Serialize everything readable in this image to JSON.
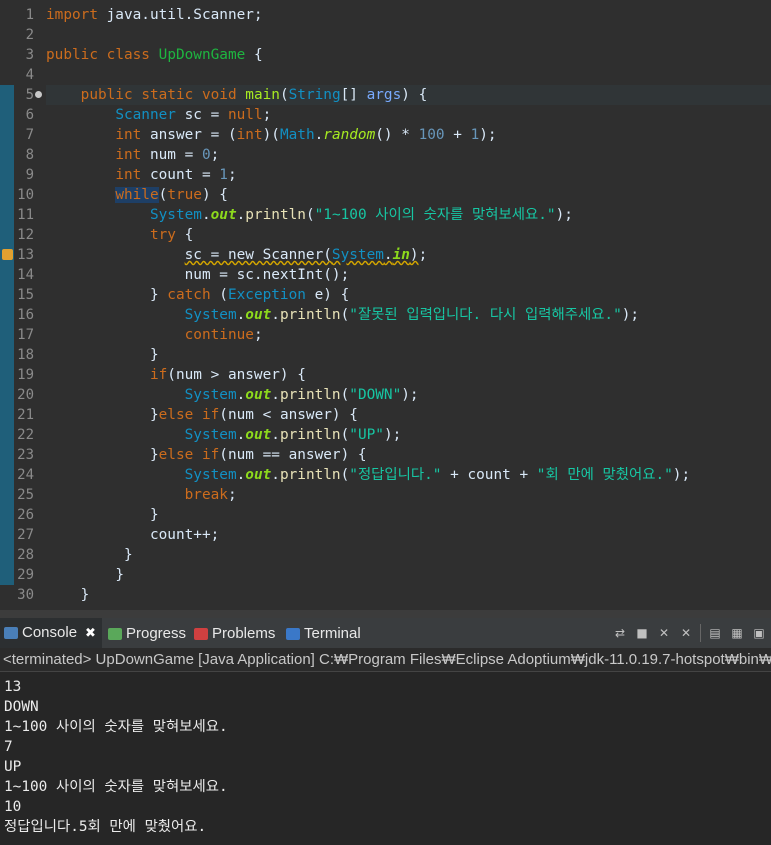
{
  "editor": {
    "lines": [
      {
        "n": "1",
        "tokens": [
          {
            "t": "import",
            "c": "kw"
          },
          {
            "t": " java.util.Scanner;",
            "c": "var"
          }
        ]
      },
      {
        "n": "2",
        "tokens": []
      },
      {
        "n": "3",
        "tokens": [
          {
            "t": "public",
            "c": "kw"
          },
          {
            "t": " "
          },
          {
            "t": "class",
            "c": "kw"
          },
          {
            "t": " "
          },
          {
            "t": "UpDownGame",
            "c": "cls"
          },
          {
            "t": " {"
          }
        ]
      },
      {
        "n": "4",
        "tokens": []
      },
      {
        "n": "5",
        "fold": true,
        "cur": true,
        "tokens": [
          {
            "t": "    "
          },
          {
            "t": "public",
            "c": "kw"
          },
          {
            "t": " "
          },
          {
            "t": "static",
            "c": "kw"
          },
          {
            "t": " "
          },
          {
            "t": "void",
            "c": "kw"
          },
          {
            "t": " "
          },
          {
            "t": "main",
            "c": "fn"
          },
          {
            "t": "("
          },
          {
            "t": "String",
            "c": "ty"
          },
          {
            "t": "[] "
          },
          {
            "t": "args",
            "c": "param"
          },
          {
            "t": ") {"
          }
        ]
      },
      {
        "n": "6",
        "tokens": [
          {
            "t": "        "
          },
          {
            "t": "Scanner",
            "c": "ty"
          },
          {
            "t": " sc = "
          },
          {
            "t": "null",
            "c": "kw"
          },
          {
            "t": ";"
          }
        ]
      },
      {
        "n": "7",
        "tokens": [
          {
            "t": "        "
          },
          {
            "t": "int",
            "c": "kw"
          },
          {
            "t": " answer = ("
          },
          {
            "t": "int",
            "c": "kw"
          },
          {
            "t": ")("
          },
          {
            "t": "Math",
            "c": "ty"
          },
          {
            "t": "."
          },
          {
            "t": "random",
            "c": "fn",
            "i": true
          },
          {
            "t": "() * "
          },
          {
            "t": "100",
            "c": "num"
          },
          {
            "t": " + "
          },
          {
            "t": "1",
            "c": "num"
          },
          {
            "t": ");"
          }
        ]
      },
      {
        "n": "8",
        "tokens": [
          {
            "t": "        "
          },
          {
            "t": "int",
            "c": "kw"
          },
          {
            "t": " num = "
          },
          {
            "t": "0",
            "c": "num"
          },
          {
            "t": ";"
          }
        ]
      },
      {
        "n": "9",
        "tokens": [
          {
            "t": "        "
          },
          {
            "t": "int",
            "c": "kw"
          },
          {
            "t": " count = "
          },
          {
            "t": "1",
            "c": "num"
          },
          {
            "t": ";"
          }
        ]
      },
      {
        "n": "10",
        "tokens": [
          {
            "t": "        "
          },
          {
            "t": "while",
            "c": "kw sel"
          },
          {
            "t": "("
          },
          {
            "t": "true",
            "c": "kw"
          },
          {
            "t": ") {"
          }
        ]
      },
      {
        "n": "11",
        "tokens": [
          {
            "t": "            "
          },
          {
            "t": "System",
            "c": "ty"
          },
          {
            "t": "."
          },
          {
            "t": "out",
            "c": "fld"
          },
          {
            "t": "."
          },
          {
            "t": "println",
            "c": "mth"
          },
          {
            "t": "("
          },
          {
            "t": "\"1~100 사이의 숫자를 맞혀보세요.\"",
            "c": "str"
          },
          {
            "t": ");"
          }
        ]
      },
      {
        "n": "12",
        "tokens": [
          {
            "t": "            "
          },
          {
            "t": "try",
            "c": "kw"
          },
          {
            "t": " {"
          }
        ]
      },
      {
        "n": "13",
        "warn": true,
        "tokens": [
          {
            "t": "                "
          },
          {
            "t": "sc = new Scanner(",
            "c": "var wavy"
          },
          {
            "t": "System",
            "c": "ty wavy"
          },
          {
            "t": ".",
            "c": "wavy"
          },
          {
            "t": "in",
            "c": "fld wavy"
          },
          {
            "t": ")",
            "c": "wavy"
          },
          {
            "t": ";"
          }
        ]
      },
      {
        "n": "14",
        "tokens": [
          {
            "t": "                "
          },
          {
            "t": "num = sc.nextInt();"
          }
        ]
      },
      {
        "n": "15",
        "tokens": [
          {
            "t": "            "
          },
          {
            "t": "} "
          },
          {
            "t": "catch",
            "c": "kw"
          },
          {
            "t": " ("
          },
          {
            "t": "Exception",
            "c": "ty"
          },
          {
            "t": " e) {"
          }
        ]
      },
      {
        "n": "16",
        "tokens": [
          {
            "t": "                "
          },
          {
            "t": "System",
            "c": "ty"
          },
          {
            "t": "."
          },
          {
            "t": "out",
            "c": "fld"
          },
          {
            "t": "."
          },
          {
            "t": "println",
            "c": "mth"
          },
          {
            "t": "("
          },
          {
            "t": "\"잘못된 입력입니다. 다시 입력해주세요.\"",
            "c": "str"
          },
          {
            "t": ");"
          }
        ]
      },
      {
        "n": "17",
        "tokens": [
          {
            "t": "                "
          },
          {
            "t": "continue",
            "c": "kw"
          },
          {
            "t": ";"
          }
        ]
      },
      {
        "n": "18",
        "tokens": [
          {
            "t": "            "
          },
          {
            "t": "}"
          }
        ]
      },
      {
        "n": "19",
        "tokens": [
          {
            "t": "            "
          },
          {
            "t": "if",
            "c": "kw"
          },
          {
            "t": "(num > answer) {"
          }
        ]
      },
      {
        "n": "20",
        "tokens": [
          {
            "t": "                "
          },
          {
            "t": "System",
            "c": "ty"
          },
          {
            "t": "."
          },
          {
            "t": "out",
            "c": "fld"
          },
          {
            "t": "."
          },
          {
            "t": "println",
            "c": "mth"
          },
          {
            "t": "("
          },
          {
            "t": "\"DOWN\"",
            "c": "str"
          },
          {
            "t": ");"
          }
        ]
      },
      {
        "n": "21",
        "tokens": [
          {
            "t": "            "
          },
          {
            "t": "}"
          },
          {
            "t": "else",
            "c": "kw"
          },
          {
            "t": " "
          },
          {
            "t": "if",
            "c": "kw"
          },
          {
            "t": "(num < answer) {"
          }
        ]
      },
      {
        "n": "22",
        "tokens": [
          {
            "t": "                "
          },
          {
            "t": "System",
            "c": "ty"
          },
          {
            "t": "."
          },
          {
            "t": "out",
            "c": "fld"
          },
          {
            "t": "."
          },
          {
            "t": "println",
            "c": "mth"
          },
          {
            "t": "("
          },
          {
            "t": "\"UP\"",
            "c": "str"
          },
          {
            "t": ");"
          }
        ]
      },
      {
        "n": "23",
        "tokens": [
          {
            "t": "            "
          },
          {
            "t": "}"
          },
          {
            "t": "else",
            "c": "kw"
          },
          {
            "t": " "
          },
          {
            "t": "if",
            "c": "kw"
          },
          {
            "t": "(num == answer) {"
          }
        ]
      },
      {
        "n": "24",
        "tokens": [
          {
            "t": "                "
          },
          {
            "t": "System",
            "c": "ty"
          },
          {
            "t": "."
          },
          {
            "t": "out",
            "c": "fld"
          },
          {
            "t": "."
          },
          {
            "t": "println",
            "c": "mth"
          },
          {
            "t": "("
          },
          {
            "t": "\"정답입니다.\"",
            "c": "str"
          },
          {
            "t": " + count + "
          },
          {
            "t": "\"회 만에 맞췄어요.\"",
            "c": "str"
          },
          {
            "t": ");"
          }
        ]
      },
      {
        "n": "25",
        "tokens": [
          {
            "t": "                "
          },
          {
            "t": "break",
            "c": "kw"
          },
          {
            "t": ";"
          }
        ]
      },
      {
        "n": "26",
        "tokens": [
          {
            "t": "            "
          },
          {
            "t": "}"
          }
        ]
      },
      {
        "n": "27",
        "tokens": [
          {
            "t": "            "
          },
          {
            "t": "count++;"
          }
        ]
      },
      {
        "n": "28",
        "tokens": [
          {
            "t": "         "
          },
          {
            "t": "}"
          }
        ]
      },
      {
        "n": "29",
        "tokens": [
          {
            "t": "        "
          },
          {
            "t": "}"
          }
        ]
      },
      {
        "n": "30",
        "tokens": [
          {
            "t": "    "
          },
          {
            "t": "}"
          }
        ]
      }
    ]
  },
  "tabs": [
    {
      "id": "console",
      "label": "Console",
      "icon": "console-icon",
      "active": true,
      "color": "#4a7fb8"
    },
    {
      "id": "progress",
      "label": "Progress",
      "icon": "progress-icon",
      "active": false,
      "color": "#5aa85a"
    },
    {
      "id": "problems",
      "label": "Problems",
      "icon": "problems-icon",
      "active": false,
      "color": "#d04040"
    },
    {
      "id": "terminal",
      "label": "Terminal",
      "icon": "terminal-icon",
      "active": false,
      "color": "#3a78c8"
    }
  ],
  "toolbar": [
    "pin-icon",
    "stop-icon",
    "remove-launch-icon",
    "remove-all-icon",
    "display-selected-console-icon",
    "new-console-icon",
    "open-console-icon"
  ],
  "console": {
    "status": "<terminated> UpDownGame [Java Application] C:₩Program Files₩Eclipse Adoptium₩jdk-11.0.19.7-hotspot₩bin₩javaw.exe",
    "lines": [
      "13",
      "DOWN",
      "1~100 사이의 숫자를 맞혀보세요.",
      "7",
      "UP",
      "1~100 사이의 숫자를 맞혀보세요.",
      "10",
      "정답입니다.5회 만에 맞췄어요."
    ]
  }
}
